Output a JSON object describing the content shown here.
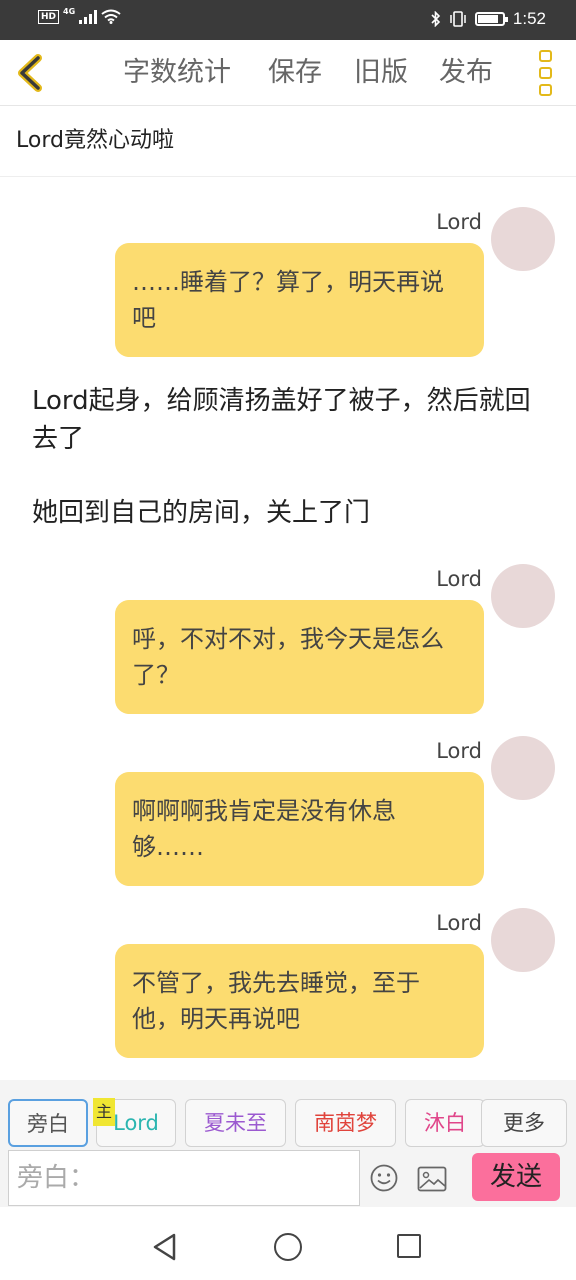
{
  "status_bar": {
    "left_badges": [
      "HD",
      "4G"
    ],
    "time": "1:52",
    "battery_level": 0.85,
    "icons": [
      "signal-icon",
      "wifi-icon",
      "bluetooth-icon",
      "vibrate-icon",
      "battery-icon"
    ]
  },
  "toolbar": {
    "back_icon": "chevron-left-icon",
    "word_count": "字数统计",
    "save": "保存",
    "old_version": "旧版",
    "publish": "发布",
    "menu_icon": "more-vertical-icon",
    "accent_color": "#e3b91a"
  },
  "chapter": {
    "title": "Lord竟然心动啦"
  },
  "messages": [
    {
      "type": "dialogue",
      "name": "Lord",
      "text": "……睡着了？算了，明天再说吧"
    },
    {
      "type": "narration",
      "text": "Lord起身，给顾清扬盖好了被子，然后就回去了"
    },
    {
      "type": "narration",
      "text": "她回到自己的房间，关上了门"
    },
    {
      "type": "dialogue",
      "name": "Lord",
      "text": "呼，不对不对，我今天是怎么了？"
    },
    {
      "type": "dialogue",
      "name": "Lord",
      "text": "啊啊啊我肯定是没有休息够……"
    },
    {
      "type": "dialogue",
      "name": "Lord",
      "text": "不管了，我先去睡觉，至于他，明天再说吧"
    }
  ],
  "roles": [
    {
      "label": "旁白",
      "color": "#555555"
    },
    {
      "label": "Lord",
      "color": "#2bb5b0",
      "badge": "主"
    },
    {
      "label": "夏未至",
      "color": "#9b59d0"
    },
    {
      "label": "南茵梦",
      "color": "#e0433b"
    },
    {
      "label": "沐白",
      "color": "#e0468a"
    },
    {
      "label": "更多",
      "color": "#444444"
    }
  ],
  "composer": {
    "placeholder": "旁白：",
    "emoji_icon": "smiley-icon",
    "image_icon": "image-icon",
    "send_label": "发送",
    "send_color": "#fb6f9c"
  },
  "nav_bar": {
    "icons": [
      "back-triangle-icon",
      "home-circle-icon",
      "recent-square-icon"
    ]
  }
}
